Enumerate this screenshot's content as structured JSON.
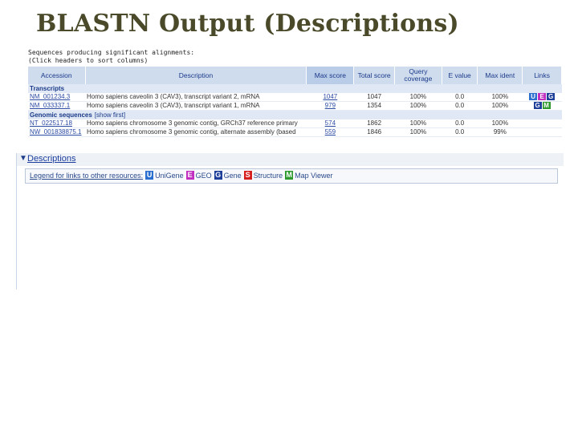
{
  "slide": {
    "title": "BLASTN Output (Descriptions)"
  },
  "panel": {
    "toggle_glyph": "▼",
    "title": "Descriptions",
    "legend": {
      "label": "Legend for links to other resources:",
      "items": [
        {
          "badge": "U",
          "name": "UniGene",
          "color": "#2a6fcf"
        },
        {
          "badge": "E",
          "name": "GEO",
          "color": "#c02fbf"
        },
        {
          "badge": "G",
          "name": "Gene",
          "color": "#1d3f9a"
        },
        {
          "badge": "S",
          "name": "Structure",
          "color": "#d61f1f"
        },
        {
          "badge": "M",
          "name": "Map Viewer",
          "color": "#2e9a2e"
        }
      ]
    }
  },
  "results": {
    "caption_line1": "Sequences producing significant alignments:",
    "caption_line2": "(Click headers to sort columns)",
    "columns": {
      "accession": "Accession",
      "description": "Description",
      "max_score": "Max score",
      "total_score": "Total score",
      "query_coverage": "Query coverage",
      "e_value": "E value",
      "max_ident": "Max ident",
      "links": "Links"
    },
    "groups": [
      {
        "label": "Transcripts",
        "show_first": "",
        "rows": [
          {
            "accession": "NM_001234.3",
            "description": "Homo sapiens caveolin 3 (CAV3), transcript variant 2, mRNA",
            "max_score": "1047",
            "total_score": "1047",
            "query_coverage": "100%",
            "e_value": "0.0",
            "max_ident": "100%",
            "links": [
              "U",
              "E",
              "G"
            ]
          },
          {
            "accession": "NM_033337.1",
            "description": "Homo sapiens caveolin 3 (CAV3), transcript variant 1, mRNA",
            "max_score": "979",
            "total_score": "1354",
            "query_coverage": "100%",
            "e_value": "0.0",
            "max_ident": "100%",
            "links": [
              "G",
              "M"
            ]
          }
        ]
      },
      {
        "label": "Genomic sequences",
        "show_first": "[show first]",
        "rows": [
          {
            "accession": "NT_022517.18",
            "description": "Homo sapiens chromosome 3 genomic contig, GRCh37 reference primary",
            "max_score": "574",
            "total_score": "1862",
            "query_coverage": "100%",
            "e_value": "0.0",
            "max_ident": "100%",
            "links": []
          },
          {
            "accession": "NW_001838875.1",
            "description": "Homo sapiens chromosome 3 genomic contig, alternate assembly (based",
            "max_score": "559",
            "total_score": "1846",
            "query_coverage": "100%",
            "e_value": "0.0",
            "max_ident": "99%",
            "links": []
          }
        ]
      }
    ]
  }
}
